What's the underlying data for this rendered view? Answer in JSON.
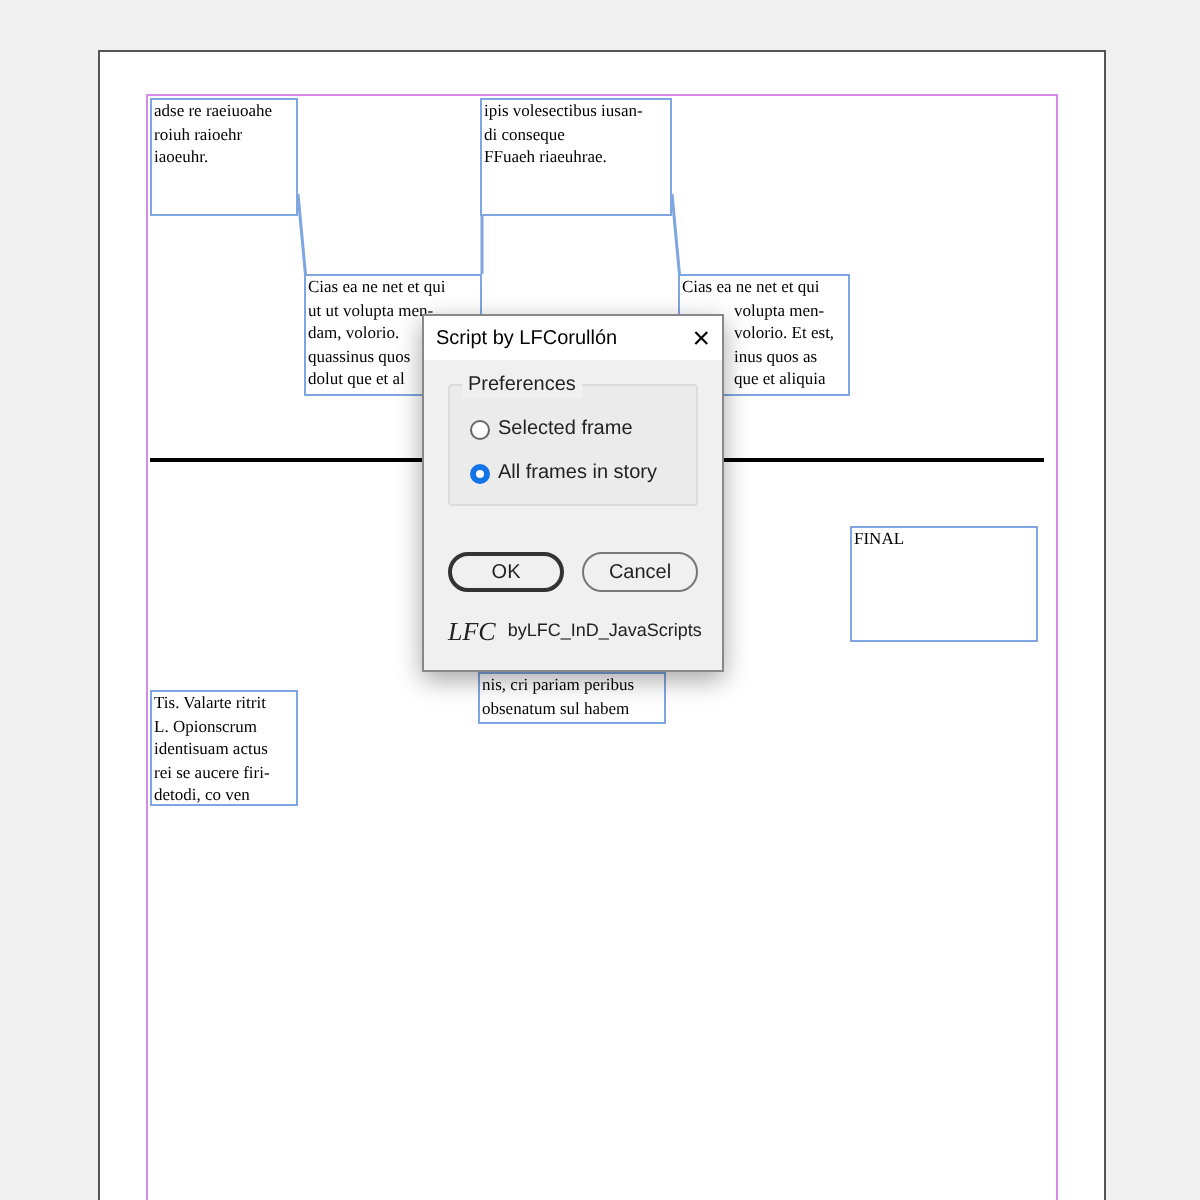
{
  "frames": [
    {
      "lines": [
        "adse re raeiuoahe",
        "roiuh raioehr",
        "iaoeuhr."
      ]
    },
    {
      "lines": [
        "ipis volesectibus iusan-",
        "di conseque",
        "FFuaeh riaeuhrae."
      ]
    },
    {
      "lines": [
        "Cias ea ne net et qui",
        "ut ut volupta men-",
        "dam, volorio.",
        "quassinus quos",
        "dolut que et al"
      ]
    },
    {
      "lines": [
        "Cias ea ne net et qui",
        "volupta men-",
        "volorio. Et est,",
        "inus quos as",
        "que et aliquia"
      ]
    },
    {
      "lines": [
        "FINAL"
      ]
    },
    {
      "lines": [
        "Tis. Valarte ritrit",
        "L. Opionscrum",
        "identisuam actus",
        "rei se aucere firi-",
        "detodi, co ven"
      ]
    },
    {
      "lines": [
        "nis, cri pariam peribus",
        "obsenatum sul habem"
      ]
    }
  ],
  "dialog": {
    "title": "Script by LFCorullón",
    "close": "×",
    "group_label": "Preferences",
    "options": [
      {
        "label": "Selected frame",
        "selected": false
      },
      {
        "label": "All frames in story",
        "selected": true
      }
    ],
    "buttons": [
      {
        "label": "OK",
        "focused": true
      },
      {
        "label": "Cancel",
        "focused": false
      }
    ],
    "logo": "LFC",
    "footer": "byLFC_InD_JavaScripts"
  }
}
